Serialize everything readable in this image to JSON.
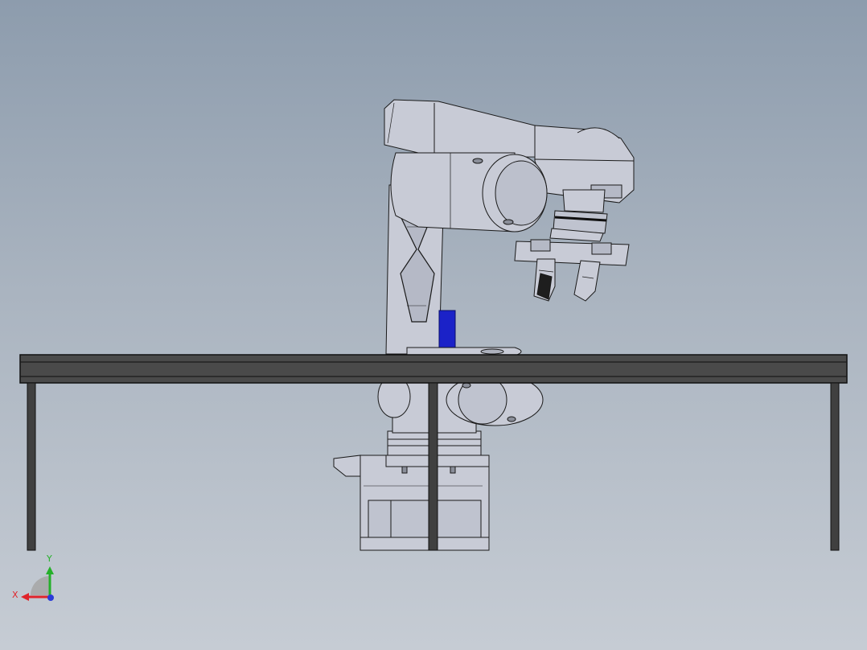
{
  "view": {
    "background_top": "#8d9cad",
    "background_bottom": "#c6ccd4"
  },
  "model": {
    "part_color": "#c8cbd6",
    "edge_color": "#1a1a1a",
    "table_color": "#3e3e3e",
    "marker_color": "#1b22c8"
  },
  "triad": {
    "x_label": "X",
    "y_label": "Y",
    "x_color": "#e0242b",
    "y_color": "#25b02a",
    "z_color": "#2b3bd8"
  }
}
